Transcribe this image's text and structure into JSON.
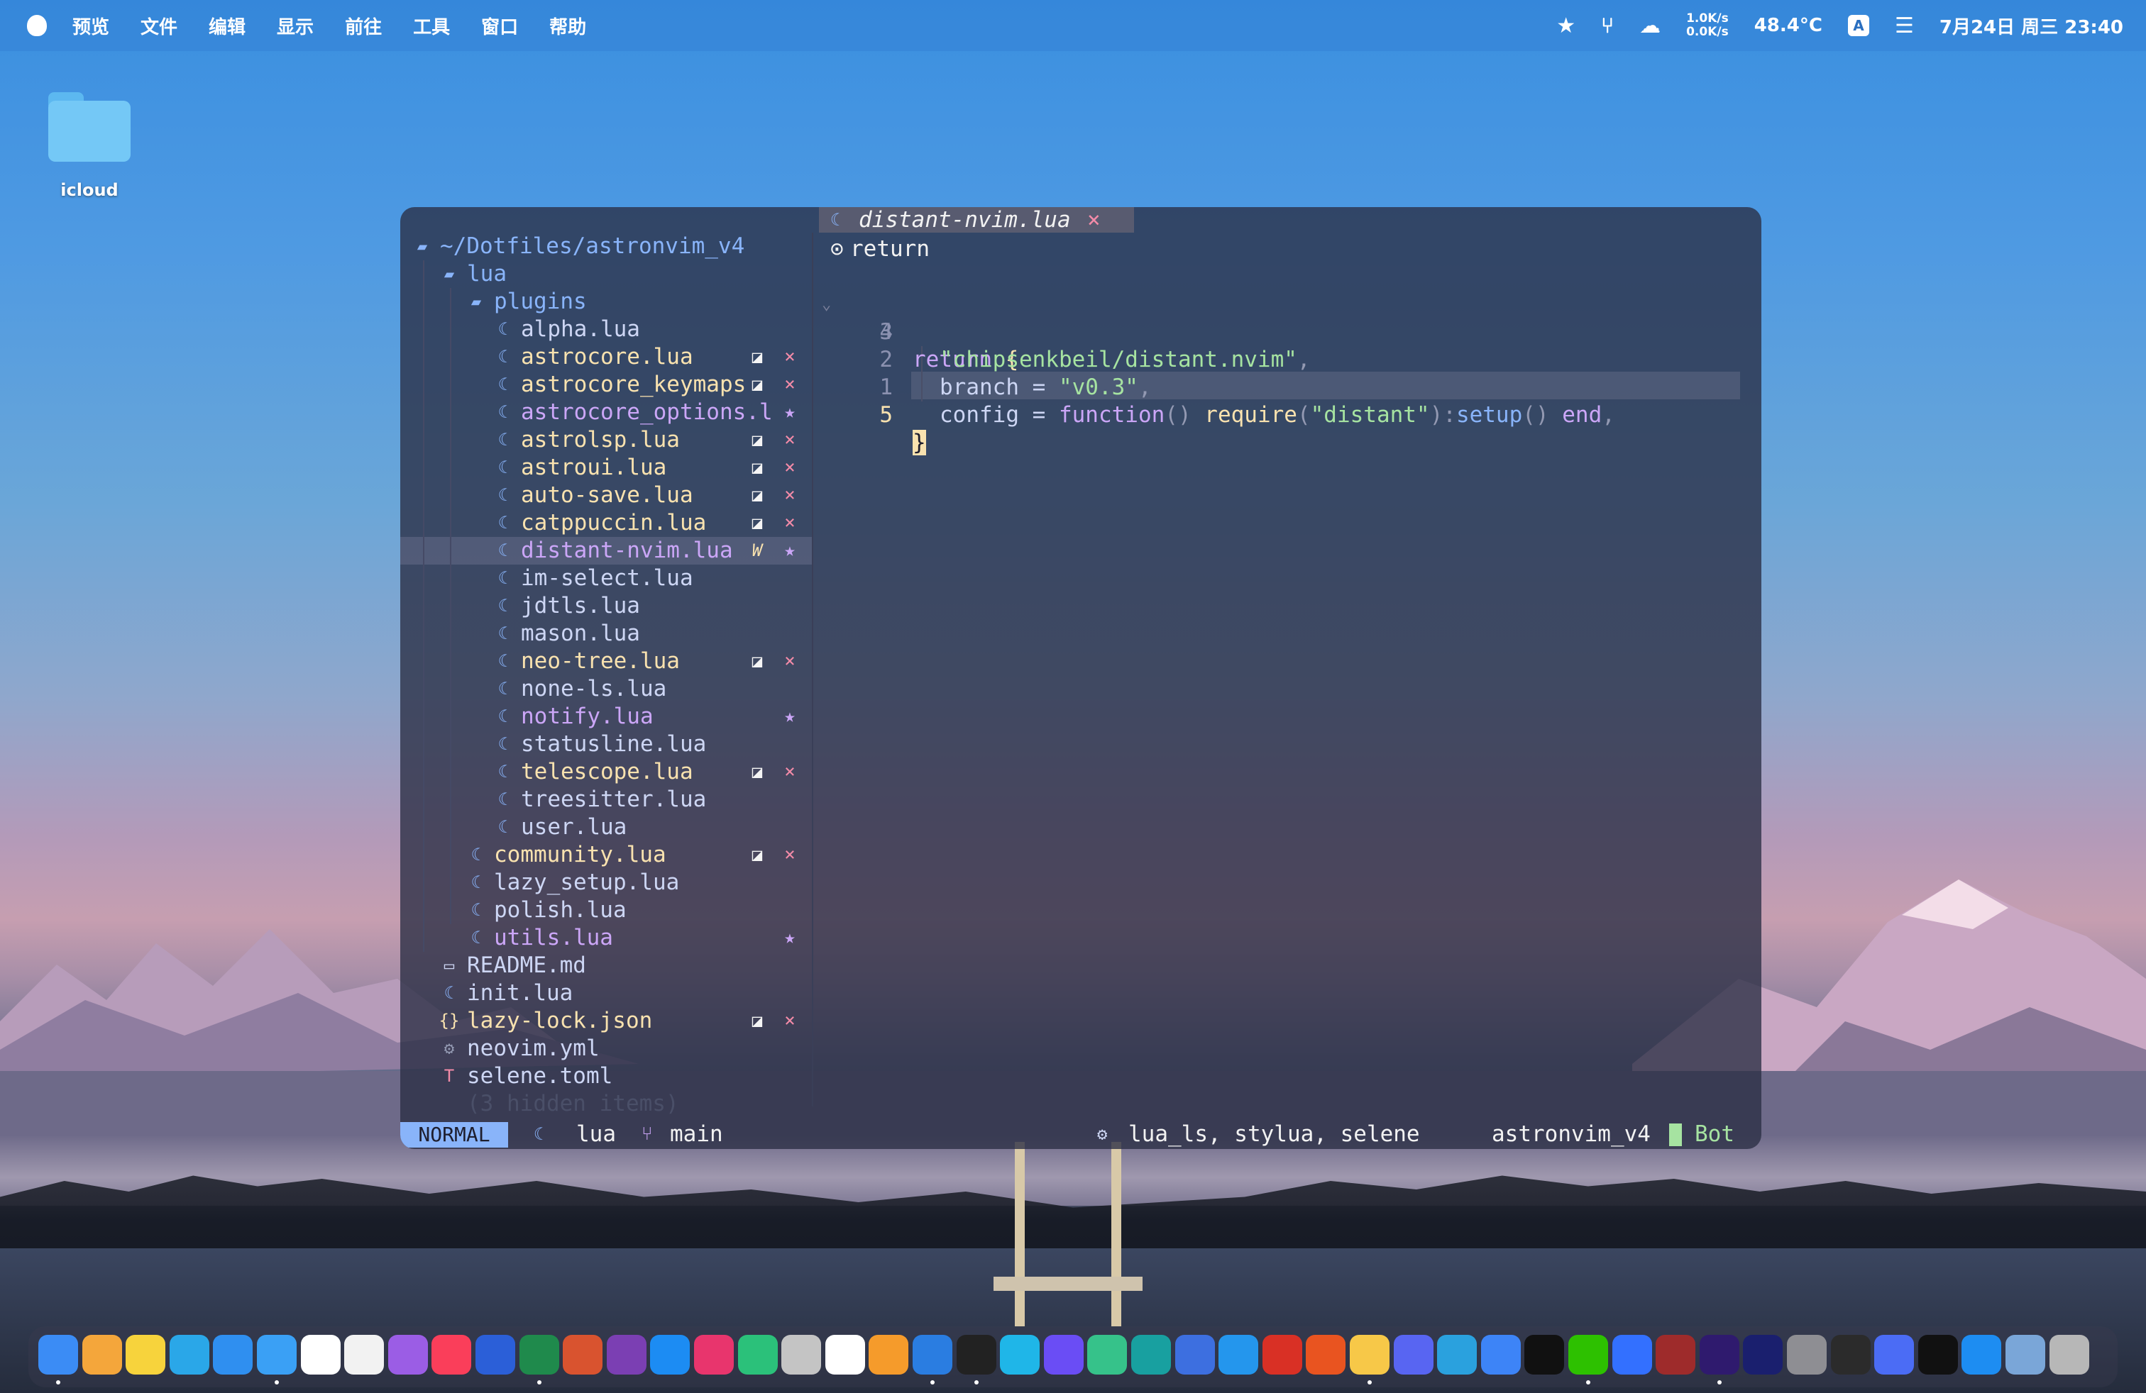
{
  "menubar": {
    "menus": [
      "预览",
      "文件",
      "编辑",
      "显示",
      "前往",
      "工具",
      "窗口",
      "帮助"
    ],
    "net_up": "1.0K/s",
    "net_down": "0.0K/s",
    "temperature": "48.4°C",
    "input_method": "A",
    "datetime": "7月24日 周三 23:40"
  },
  "desktop": {
    "folder_label": "icloud"
  },
  "tree": {
    "root": "~/Dotfiles/astronvim_v4",
    "items": [
      {
        "name": "lua",
        "kind": "dir",
        "depth": 1,
        "color": "dir"
      },
      {
        "name": "plugins",
        "kind": "dir",
        "depth": 2,
        "color": "dir"
      },
      {
        "name": "alpha.lua",
        "depth": 3,
        "color": "plain"
      },
      {
        "name": "astrocore.lua",
        "depth": 3,
        "color": "mod",
        "git": "mod",
        "status": "×"
      },
      {
        "name": "astrocore_keymaps",
        "depth": 3,
        "color": "mod",
        "git": "mod",
        "status": "×"
      },
      {
        "name": "astrocore_options.l",
        "depth": 3,
        "color": "new",
        "status": "★"
      },
      {
        "name": "astrolsp.lua",
        "depth": 3,
        "color": "mod",
        "git": "mod",
        "status": "×"
      },
      {
        "name": "astroui.lua",
        "depth": 3,
        "color": "mod",
        "git": "mod",
        "status": "×"
      },
      {
        "name": "auto-save.lua",
        "depth": 3,
        "color": "mod",
        "git": "mod",
        "status": "×"
      },
      {
        "name": "catppuccin.lua",
        "depth": 3,
        "color": "mod",
        "git": "mod",
        "status": "×"
      },
      {
        "name": "distant-nvim.lua",
        "depth": 3,
        "color": "new",
        "git": "W",
        "status": "★",
        "selected": true
      },
      {
        "name": "im-select.lua",
        "depth": 3,
        "color": "plain"
      },
      {
        "name": "jdtls.lua",
        "depth": 3,
        "color": "plain"
      },
      {
        "name": "mason.lua",
        "depth": 3,
        "color": "plain"
      },
      {
        "name": "neo-tree.lua",
        "depth": 3,
        "color": "mod",
        "git": "mod",
        "status": "×"
      },
      {
        "name": "none-ls.lua",
        "depth": 3,
        "color": "plain"
      },
      {
        "name": "notify.lua",
        "depth": 3,
        "color": "new",
        "status": "★"
      },
      {
        "name": "statusline.lua",
        "depth": 3,
        "color": "plain"
      },
      {
        "name": "telescope.lua",
        "depth": 3,
        "color": "mod",
        "git": "mod",
        "status": "×"
      },
      {
        "name": "treesitter.lua",
        "depth": 3,
        "color": "plain"
      },
      {
        "name": "user.lua",
        "depth": 3,
        "color": "plain"
      },
      {
        "name": "community.lua",
        "depth": 2,
        "color": "mod",
        "git": "mod",
        "status": "×"
      },
      {
        "name": "lazy_setup.lua",
        "depth": 2,
        "color": "plain"
      },
      {
        "name": "polish.lua",
        "depth": 2,
        "color": "plain"
      },
      {
        "name": "utils.lua",
        "depth": 2,
        "color": "new",
        "status": "★"
      },
      {
        "name": "README.md",
        "depth": 1,
        "color": "plain",
        "icon": "md"
      },
      {
        "name": "init.lua",
        "depth": 1,
        "color": "plain"
      },
      {
        "name": "lazy-lock.json",
        "depth": 1,
        "color": "mod",
        "git": "mod",
        "status": "×",
        "icon": "json"
      },
      {
        "name": "neovim.yml",
        "depth": 1,
        "color": "plain",
        "icon": "yml"
      },
      {
        "name": "selene.toml",
        "depth": 1,
        "color": "plain",
        "icon": "toml"
      },
      {
        "name": "(3 hidden items)",
        "depth": 1,
        "color": "hidden",
        "noicon": true
      }
    ]
  },
  "editor": {
    "tab_name": "distant-nvim.lua",
    "tab_close": "×",
    "breadcrumb": "return",
    "line_numbers": [
      "4",
      "3",
      "2",
      "1",
      "5"
    ],
    "lines": {
      "l1_kw": "return",
      "l1_br": "{",
      "l2_str": "\"chipsenkbeil/distant.nvim\"",
      "l2_p": ",",
      "l3_key": "branch = ",
      "l3_str": "\"v0.3\"",
      "l3_p": ",",
      "l4_key": "config = ",
      "l4_fn": "function",
      "l4_p1": "() ",
      "l4_req": "require",
      "l4_p2": "(",
      "l4_str": "\"distant\"",
      "l4_p3": "):",
      "l4_setup": "setup",
      "l4_p4": "() ",
      "l4_end": "end",
      "l4_p5": ",",
      "l5_br": "}"
    }
  },
  "status": {
    "mode": "NORMAL",
    "filetype": "lua",
    "branch": "main",
    "lsp": "lua_ls, stylua, selene",
    "cwd": "astronvim_v4",
    "position": "Bot"
  },
  "colors": {
    "accent": "#89b4fa",
    "modified": "#f9e2af",
    "new": "#cba6f7",
    "error": "#f38ba8",
    "string": "#a6e3a1"
  },
  "dock": {
    "apps": [
      "finder",
      "launchpad",
      "notes",
      "edge",
      "safari",
      "mail",
      "calendar",
      "reminders",
      "podcasts",
      "music",
      "word",
      "excel",
      "powerpoint",
      "onenote",
      "app-store",
      "intellij",
      "pycharm",
      "dictionary",
      "notion",
      "sublime",
      "vscode",
      "terminal",
      "todesk",
      "warp",
      "text-editor",
      "gitkraken",
      "stacks",
      "docker",
      "zotero",
      "multipass",
      "paw",
      "discord",
      "telegram",
      "spark",
      "qq",
      "wechat",
      "feishu",
      "typora",
      "premiere",
      "after-effects",
      "system-settings",
      "activity-monitor",
      "shortcuts",
      "github",
      "xcode",
      "preview",
      "trash"
    ]
  }
}
